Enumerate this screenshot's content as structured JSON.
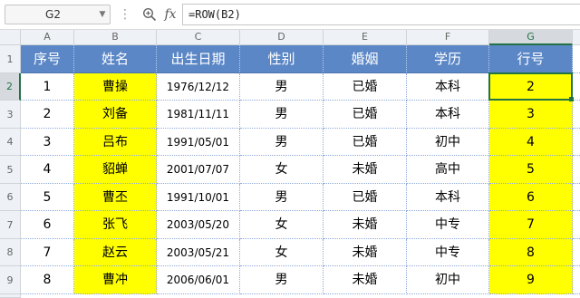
{
  "formula_bar": {
    "name_box": "G2",
    "formula": "=ROW(B2)",
    "zoom_icon": "magnifier-icon",
    "fx_label": "fx"
  },
  "columns": [
    "A",
    "B",
    "C",
    "D",
    "E",
    "F",
    "G"
  ],
  "row_numbers": [
    "1",
    "2",
    "3",
    "4",
    "5",
    "6",
    "7",
    "8",
    "9"
  ],
  "active_cell": "G2",
  "header_row": [
    "序号",
    "姓名",
    "出生日期",
    "性别",
    "婚姻",
    "学历",
    "行号"
  ],
  "rows": [
    [
      "1",
      "曹操",
      "1976/12/12",
      "男",
      "已婚",
      "本科",
      "2"
    ],
    [
      "2",
      "刘备",
      "1981/11/11",
      "男",
      "已婚",
      "本科",
      "3"
    ],
    [
      "3",
      "吕布",
      "1991/05/01",
      "男",
      "已婚",
      "初中",
      "4"
    ],
    [
      "4",
      "貂蝉",
      "2001/07/07",
      "女",
      "未婚",
      "高中",
      "5"
    ],
    [
      "5",
      "曹丕",
      "1991/10/01",
      "男",
      "已婚",
      "本科",
      "6"
    ],
    [
      "6",
      "张飞",
      "2003/05/20",
      "女",
      "未婚",
      "中专",
      "7"
    ],
    [
      "7",
      "赵云",
      "2003/05/21",
      "女",
      "未婚",
      "中专",
      "8"
    ],
    [
      "8",
      "曹冲",
      "2006/06/01",
      "男",
      "未婚",
      "初中",
      "9"
    ]
  ],
  "colors": {
    "header_fill": "#5b87c6",
    "highlight_fill": "#ffff00",
    "selection": "#217346"
  }
}
